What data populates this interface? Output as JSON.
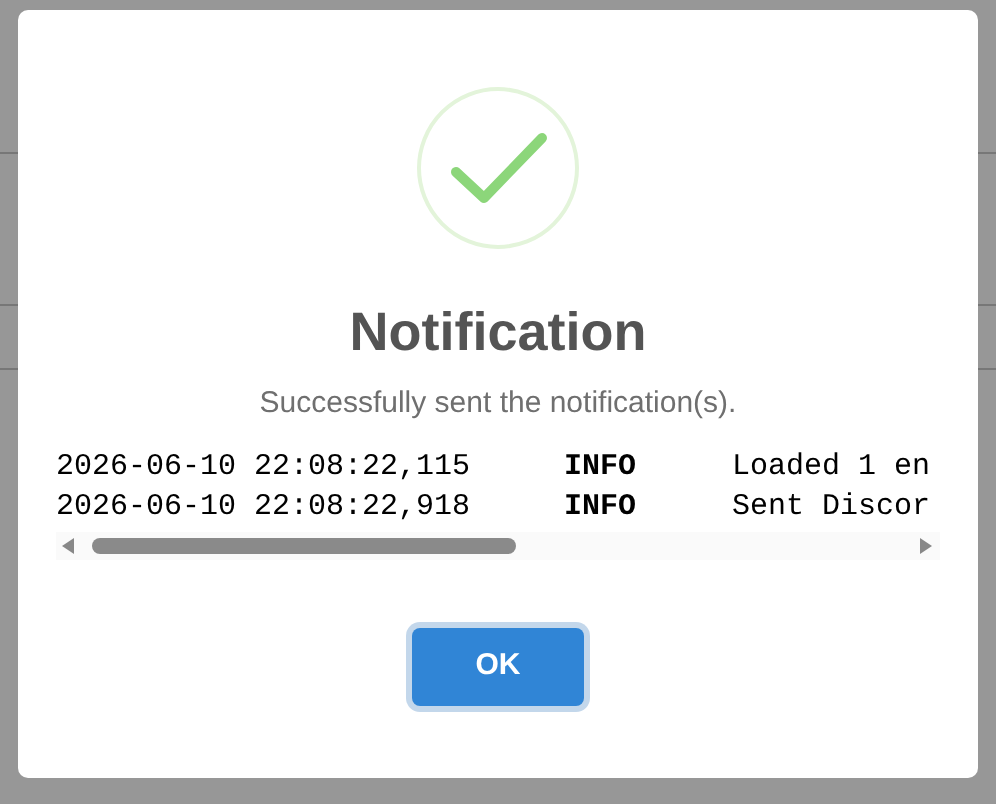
{
  "dialog": {
    "title": "Notification",
    "message": "Successfully sent the notification(s).",
    "log": [
      {
        "time": "2026-06-10 22:08:22,115",
        "level": "INFO",
        "text": "Loaded 1 en"
      },
      {
        "time": "2026-06-10 22:08:22,918",
        "level": "INFO",
        "text": "Sent Discor"
      }
    ],
    "buttons": [
      "OK"
    ]
  }
}
